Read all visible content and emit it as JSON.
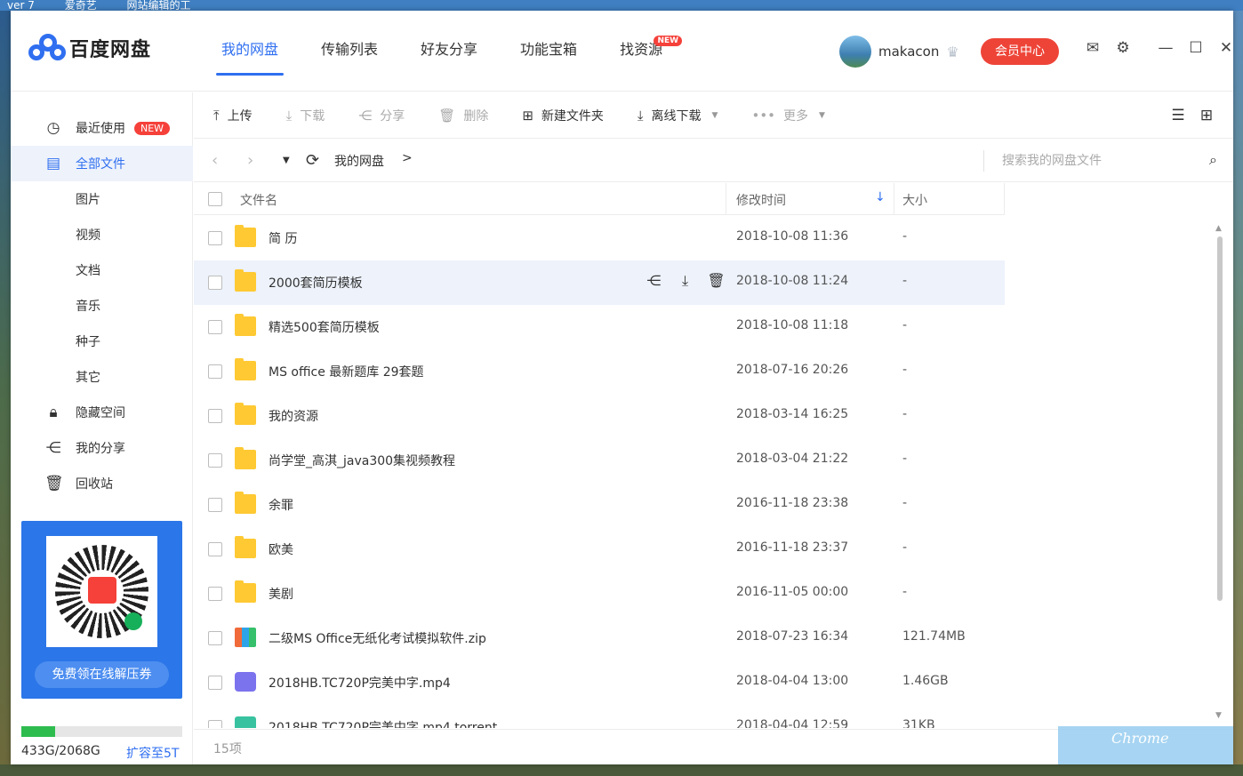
{
  "desktop": {
    "topbar_items": [
      "ver 7",
      "爱奇艺",
      "网站编辑的工"
    ]
  },
  "app": {
    "logo_text": "百度网盘",
    "nav": [
      {
        "label": "我的网盘",
        "active": true
      },
      {
        "label": "传输列表"
      },
      {
        "label": "好友分享"
      },
      {
        "label": "功能宝箱"
      },
      {
        "label": "找资源",
        "badge": "NEW"
      }
    ],
    "username": "makacon",
    "vip_label": "会员中心"
  },
  "sidebar": {
    "items": [
      {
        "label": "最近使用",
        "icon": "clock-icon",
        "badge": "NEW"
      },
      {
        "label": "全部文件",
        "icon": "file-icon",
        "active": true
      },
      {
        "label": "图片"
      },
      {
        "label": "视频"
      },
      {
        "label": "文档"
      },
      {
        "label": "音乐"
      },
      {
        "label": "种子"
      },
      {
        "label": "其它"
      },
      {
        "label": "隐藏空间",
        "icon": "lock-icon"
      },
      {
        "label": "我的分享",
        "icon": "share-icon"
      },
      {
        "label": "回收站",
        "icon": "trash-icon"
      }
    ],
    "promo_button": "免费领在线解压券",
    "quota_text": "433G/2068G",
    "quota_fraction": 0.21,
    "expand_label": "扩容至5T"
  },
  "toolbar": {
    "upload": "上传",
    "download": "下载",
    "share": "分享",
    "delete": "删除",
    "new_folder": "新建文件夹",
    "offline_download": "离线下载",
    "more": "更多"
  },
  "addressbar": {
    "breadcrumb": "我的网盘",
    "separator": ">",
    "search_placeholder": "搜索我的网盘文件"
  },
  "table": {
    "headers": {
      "name": "文件名",
      "time": "修改时间",
      "size": "大小"
    },
    "rows": [
      {
        "name": "简 历",
        "time": "2018-10-08 11:36",
        "size": "-",
        "type": "folder"
      },
      {
        "name": "2000套简历模板",
        "time": "2018-10-08 11:24",
        "size": "-",
        "type": "folder",
        "hover": true
      },
      {
        "name": "精选500套简历模板",
        "time": "2018-10-08 11:18",
        "size": "-",
        "type": "folder"
      },
      {
        "name": "MS office 最新题库 29套题",
        "time": "2018-07-16 20:26",
        "size": "-",
        "type": "folder"
      },
      {
        "name": "我的资源",
        "time": "2018-03-14 16:25",
        "size": "-",
        "type": "folder"
      },
      {
        "name": "尚学堂_高淇_java300集视频教程",
        "time": "2018-03-04 21:22",
        "size": "-",
        "type": "folder"
      },
      {
        "name": "余罪",
        "time": "2016-11-18 23:38",
        "size": "-",
        "type": "folder"
      },
      {
        "name": "欧美",
        "time": "2016-11-18 23:37",
        "size": "-",
        "type": "folder"
      },
      {
        "name": "美剧",
        "time": "2016-11-05 00:00",
        "size": "-",
        "type": "folder"
      },
      {
        "name": "二级MS Office无纸化考试模拟软件.zip",
        "time": "2018-07-23 16:34",
        "size": "121.74MB",
        "type": "zip"
      },
      {
        "name": "2018HB.TC720P完美中字.mp4",
        "time": "2018-04-04 13:00",
        "size": "1.46GB",
        "type": "video"
      },
      {
        "name": "2018HB.TC720P完美中字.mp4.torrent",
        "time": "2018-04-04 12:59",
        "size": "31KB",
        "type": "torrent"
      }
    ]
  },
  "status": {
    "count": "15项"
  },
  "watermark": "Chrome"
}
